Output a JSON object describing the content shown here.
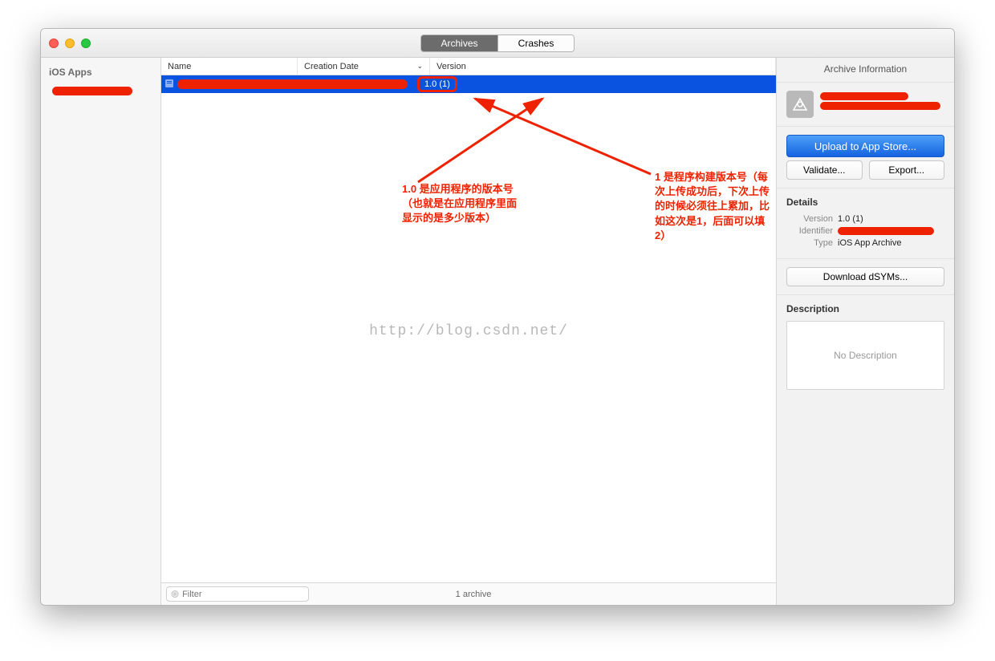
{
  "titlebar": {
    "segments": {
      "archives": "Archives",
      "crashes": "Crashes"
    }
  },
  "sidebar": {
    "header": "iOS Apps"
  },
  "columns": {
    "name": "Name",
    "creation": "Creation Date",
    "version": "Version"
  },
  "row": {
    "version": "1.0 (1)"
  },
  "watermark": "http://blog.csdn.net/",
  "footer": {
    "placeholder": "Filter",
    "count": "1 archive"
  },
  "right": {
    "header": "Archive Information",
    "upload": "Upload to App Store...",
    "validate": "Validate...",
    "export": "Export...",
    "details": "Details",
    "version_k": "Version",
    "version_v": "1.0 (1)",
    "ident_k": "Identifier",
    "type_k": "Type",
    "type_v": "iOS App Archive",
    "download": "Download dSYMs...",
    "desc_head": "Description",
    "desc_empty": "No Description"
  },
  "annotations": {
    "left": "1.0 是应用程序的版本号（也就是在应用程序里面显示的是多少版本）",
    "right": "1 是程序构建版本号（每次上传成功后，下次上传的时候必须往上累加，比如这次是1，后面可以填2）"
  }
}
